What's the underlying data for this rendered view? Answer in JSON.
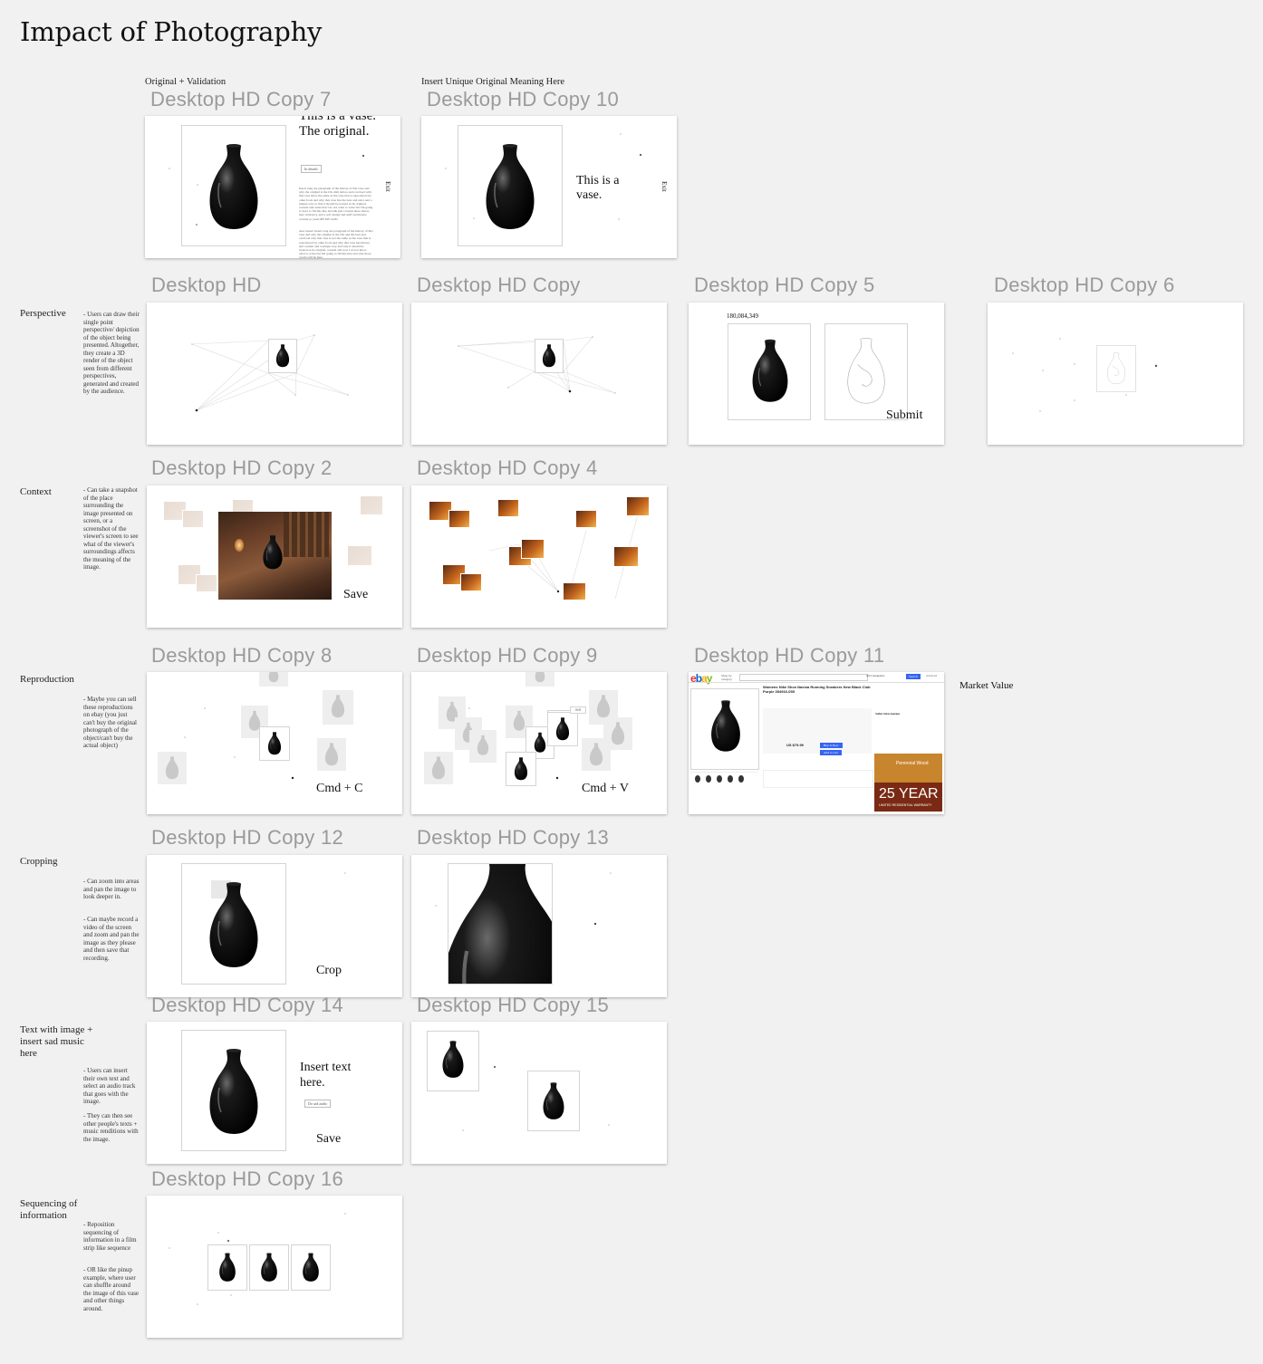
{
  "page": {
    "title": "Impact of Photography"
  },
  "top_labels": {
    "original_validation": "Original + Validation",
    "unique_meaning": "Insert Unique Original Meaning Here"
  },
  "rows": {
    "perspective": {
      "label": "Perspective",
      "note": "- Users can draw their single point perspective/ depiction of the object being presented. Altogether, they create a 3D render of the object seen from different perspectives, generated and created by the audience."
    },
    "context": {
      "label": "Context",
      "note": "- Can take a snapshot of the place surrounding the image presented on screen, or a screenshot of the viewer's screen to see what of the viewer's surroundings affects the meaning of the image."
    },
    "reproduction": {
      "label": "Reproduction",
      "note": "- Maybe you can sell these reproductions on ebay (you just can't buy the original photograph of the object/can't buy the actual object)"
    },
    "cropping": {
      "label": "Cropping",
      "note1": "- Can zoom into areas and pan the image to look deeper in.",
      "note2": "- Can maybe record a video of the screen and zoom and pan the image as they please and then save that recording."
    },
    "text_music": {
      "label": "Text with image + insert sad music here",
      "note1": "- Users can insert their own text and select an audio track that goes with the image.",
      "note2": "- They can then see other people's texts + music renditions with the image."
    },
    "sequencing": {
      "label": "Sequencing of information",
      "note1": "- Reposition sequencing of information in a film strip like sequence",
      "note2": "- OR like the pinup example, where user can shuffle around the image of this vase and other things around."
    }
  },
  "frames": {
    "copy7": {
      "name": "Desktop HD Copy 7",
      "heading": "This is a vase. The original.",
      "button": "In details",
      "exit": "Exit",
      "para1": "Insert long ass paragraph of the history of this vase and why the original is the OG dish before and overload with this vase since the same as the vase that is reproduced by other fools and why that vase has the best and extra and a unique way so that it should be treated as its original, content and some that I do not what to write but I'm going to have to fill this line and idk just a bunch more letters here in history, and a soft design and stuff and maybe content so yeah OH MY GOD",
      "para2": "And repeat: Insert long ass paragraph of the history of this vase and why the original is the OG and the best and overload why this vase is not the same as the vase that is reproduced by other fools and why that vase has history and content and a unique way and why it should be treated as its original, content and now I do not know what to write but I'm going to fill this line and why more words will be here"
    },
    "copy10": {
      "name": "Desktop HD Copy 10",
      "text": "This is a vase.",
      "exit": "Exit"
    },
    "hd": {
      "name": "Desktop HD"
    },
    "copy": {
      "name": "Desktop HD Copy"
    },
    "copy5": {
      "name": "Desktop HD Copy 5",
      "count": "180,084,349",
      "button": "Submit"
    },
    "copy6": {
      "name": "Desktop HD Copy 6"
    },
    "copy2": {
      "name": "Desktop HD Copy 2",
      "button": "Save"
    },
    "copy4": {
      "name": "Desktop HD Copy 4"
    },
    "copy8": {
      "name": "Desktop HD Copy 8",
      "shortcut": "Cmd + C"
    },
    "copy9": {
      "name": "Desktop HD Copy 9",
      "shortcut": "Cmd + V",
      "tag": "Sell"
    },
    "copy11": {
      "name": "Desktop HD Copy 11",
      "side_label": "Market Value",
      "ebay_product": "Womens Nike Shox Navina Running Sneakers New Black Club Purple 354916-055",
      "ebay_price": "US $79.99",
      "ebay_buy": "Buy It Now",
      "ebay_cart": "Add to cart",
      "ebay_ad1": "Perennial Wood",
      "ebay_ad2": "25 YEAR",
      "ebay_ad3": "LIMITED RESIDENTIAL WARRANTY",
      "ebay_search": "Search",
      "ebay_advanced": "Advanced",
      "ebay_categories": "All Categories",
      "ebay_shopby": "Shop by category",
      "ebay_seller": "Seller information"
    },
    "copy12": {
      "name": "Desktop HD Copy 12",
      "button": "Crop"
    },
    "copy13": {
      "name": "Desktop HD Copy 13"
    },
    "copy14": {
      "name": "Desktop HD Copy 14",
      "text": "Insert text here.",
      "audio": "Do sad audio",
      "button": "Save"
    },
    "copy15": {
      "name": "Desktop HD Copy 15"
    },
    "copy16": {
      "name": "Desktop HD Copy 16"
    }
  },
  "colors": {
    "background": "#f1f1f1",
    "frame": "#ffffff",
    "frame_name": "#9a9a9a",
    "vase": "#0b0b0b"
  }
}
